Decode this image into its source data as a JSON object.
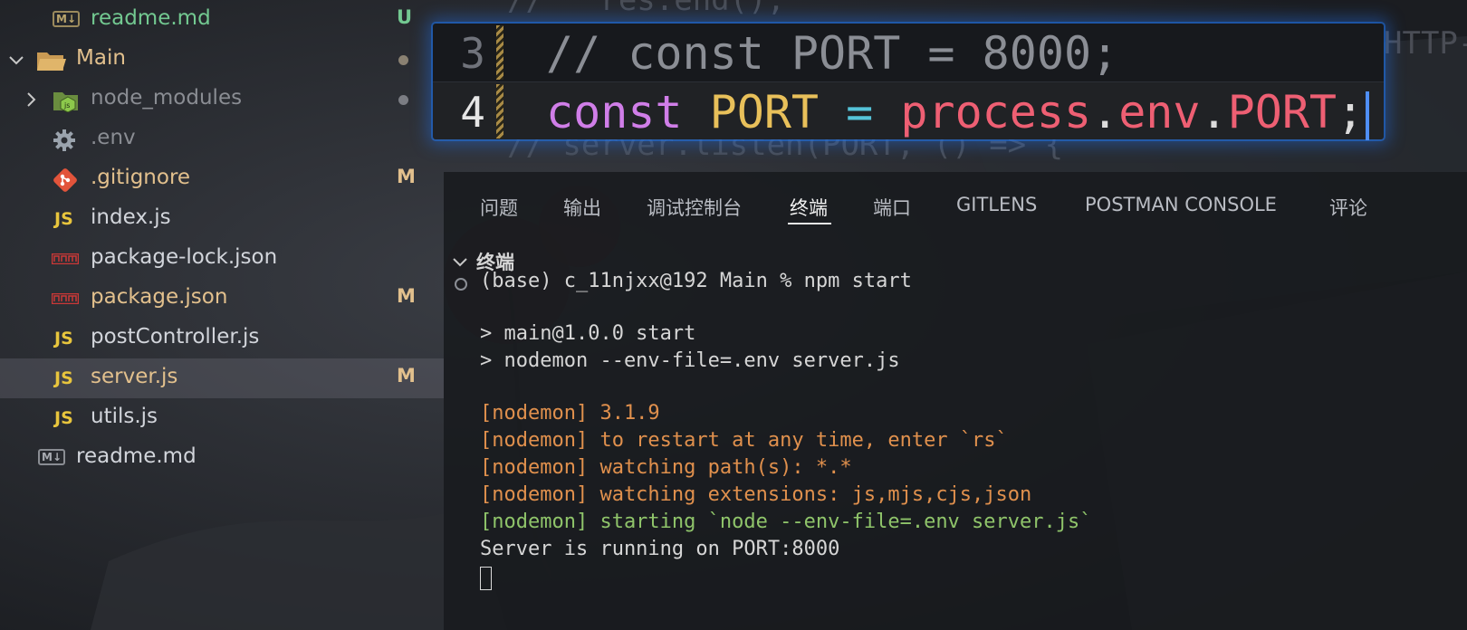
{
  "explorer": {
    "items": [
      {
        "label": "readme.md",
        "icon": "markdown-icon",
        "badge": "U",
        "status": "untracked"
      },
      {
        "label": "Main",
        "icon": "folder-open-icon",
        "status": "modified-dot"
      },
      {
        "label": "node_modules",
        "icon": "node-folder-icon",
        "status": "ignored-dot"
      },
      {
        "label": ".env",
        "icon": "gear-icon"
      },
      {
        "label": ".gitignore",
        "icon": "git-icon",
        "badge": "M"
      },
      {
        "label": "index.js",
        "icon": "js-icon"
      },
      {
        "label": "package-lock.json",
        "icon": "npm-icon"
      },
      {
        "label": "package.json",
        "icon": "npm-icon",
        "badge": "M"
      },
      {
        "label": "postController.js",
        "icon": "js-icon"
      },
      {
        "label": "server.js",
        "icon": "js-icon",
        "badge": "M",
        "selected": true
      },
      {
        "label": "utils.js",
        "icon": "js-icon"
      },
      {
        "label": "readme.md",
        "icon": "markdown-icon"
      }
    ],
    "js_icon_text": "JS",
    "md_icon_text": "M↓",
    "colors": {
      "untracked": "#73c991",
      "modified": "#e2c08d",
      "muted": "#8a8d93",
      "text": "#d2d5db"
    }
  },
  "peek": {
    "lines": [
      {
        "number": "3",
        "code": "// const PORT = 8000;"
      },
      {
        "number": "4",
        "code": "const PORT = process.env.PORT;"
      }
    ],
    "tokens_line4": {
      "kw": "const",
      "var": "PORT",
      "op": "=",
      "obj": "process",
      "dot1": ".",
      "prop1": "env",
      "dot2": ".",
      "prop2": "PORT",
      "semi": ";"
    },
    "side_text": "HTTP-"
  },
  "background_code": {
    "top": "//   res.end();",
    "mid": "// server.listen(PORT, () => {"
  },
  "panel": {
    "tabs": [
      "问题",
      "输出",
      "调试控制台",
      "终端",
      "端口",
      "GITLENS",
      "POSTMAN CONSOLE",
      "评论"
    ],
    "active_tab": "终端",
    "section_title": "终端"
  },
  "terminal": {
    "prompt": "(base) c_11njxx@192 Main % npm start",
    "lines": [
      {
        "text": "> main@1.0.0 start",
        "color": "#d6d6d6"
      },
      {
        "text": "> nodemon --env-file=.env server.js",
        "color": "#d6d6d6"
      },
      {
        "text": "[nodemon] 3.1.9",
        "color": "#e0904d"
      },
      {
        "text": "[nodemon] to restart at any time, enter `rs`",
        "color": "#e0904d"
      },
      {
        "text": "[nodemon] watching path(s): *.*",
        "color": "#e0904d"
      },
      {
        "text": "[nodemon] watching extensions: js,mjs,cjs,json",
        "color": "#e0904d"
      },
      {
        "text": "[nodemon] starting `node --env-file=.env server.js`",
        "color": "#8fc46a"
      },
      {
        "text": "Server is running on PORT:8000",
        "color": "#d6d6d6"
      }
    ]
  }
}
